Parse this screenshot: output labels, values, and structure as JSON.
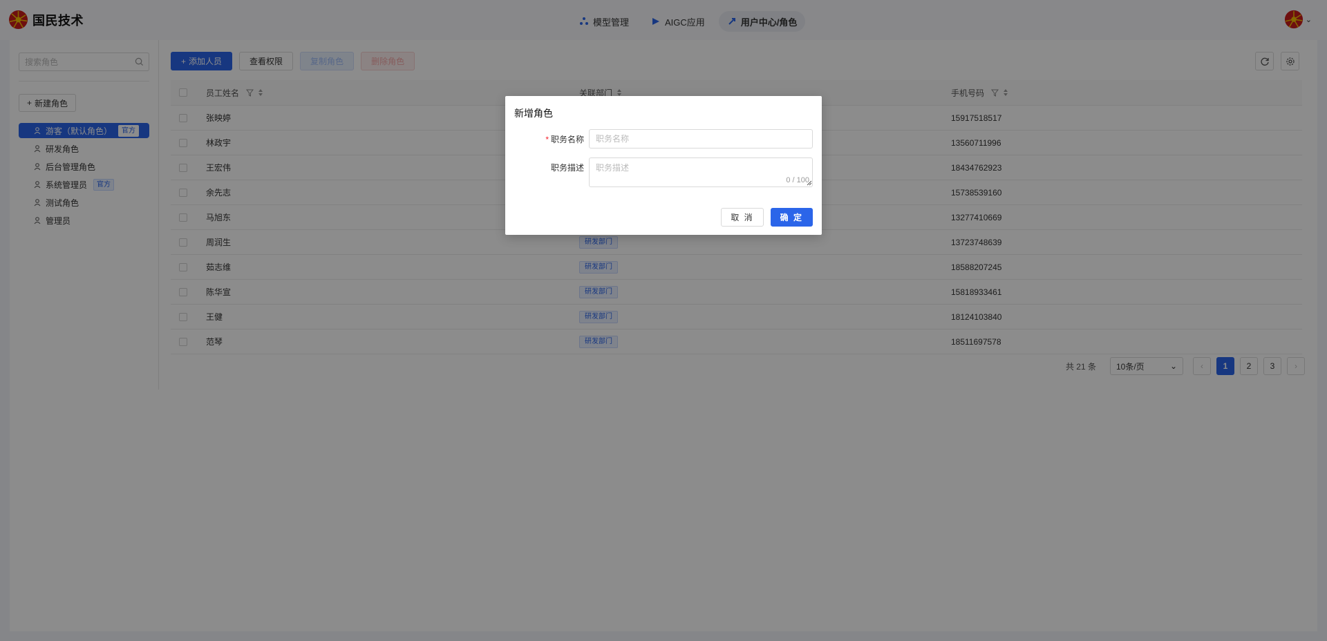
{
  "header": {
    "brand": "国民技术",
    "nav": [
      {
        "label": "模型管理"
      },
      {
        "label": "AIGC应用"
      },
      {
        "label": "用户中心/角色"
      }
    ]
  },
  "sidebar": {
    "search_placeholder": "搜索角色",
    "new_role_label": "新建角色",
    "roles": [
      {
        "label": "游客（默认角色）",
        "badge": "官方"
      },
      {
        "label": "研发角色"
      },
      {
        "label": "后台管理角色"
      },
      {
        "label": "系统管理员",
        "badge": "官方"
      },
      {
        "label": "测试角色"
      },
      {
        "label": "管理员"
      }
    ]
  },
  "toolbar": {
    "add_member": "添加人员",
    "view_permission": "查看权限",
    "copy_role": "复制角色",
    "delete_role": "删除角色"
  },
  "table": {
    "columns": {
      "name": "员工姓名",
      "dept": "关联部门",
      "phone": "手机号码"
    },
    "rows": [
      {
        "name": "张映婷",
        "dept": "",
        "phone": "15917518517"
      },
      {
        "name": "林政宇",
        "dept": "",
        "phone": "13560711996"
      },
      {
        "name": "王宏伟",
        "dept": "",
        "phone": "18434762923"
      },
      {
        "name": "余先志",
        "dept": "",
        "phone": "15738539160"
      },
      {
        "name": "马旭东",
        "dept": "",
        "phone": "13277410669"
      },
      {
        "name": "周润生",
        "dept": "研发部门",
        "phone": "13723748639"
      },
      {
        "name": "茹志维",
        "dept": "研发部门",
        "phone": "18588207245"
      },
      {
        "name": "陈华宣",
        "dept": "研发部门",
        "phone": "15818933461"
      },
      {
        "name": "王健",
        "dept": "研发部门",
        "phone": "18124103840"
      },
      {
        "name": "范琴",
        "dept": "研发部门",
        "phone": "18511697578"
      }
    ]
  },
  "pagination": {
    "total": "共 21 条",
    "page_size": "10条/页",
    "pages": [
      "1",
      "2",
      "3"
    ],
    "current": "1",
    "prev": "‹",
    "next": "›"
  },
  "modal": {
    "title": "新增角色",
    "name_label": "职务名称",
    "name_placeholder": "职务名称",
    "name_value": "",
    "desc_label": "职务描述",
    "desc_placeholder": "职务描述",
    "desc_counter": "0 / 100",
    "cancel": "取 消",
    "ok": "确 定"
  },
  "colors": {
    "primary": "#2b65e9",
    "danger": "#f5222d",
    "mask": "rgba(0,0,0,0.45)"
  }
}
